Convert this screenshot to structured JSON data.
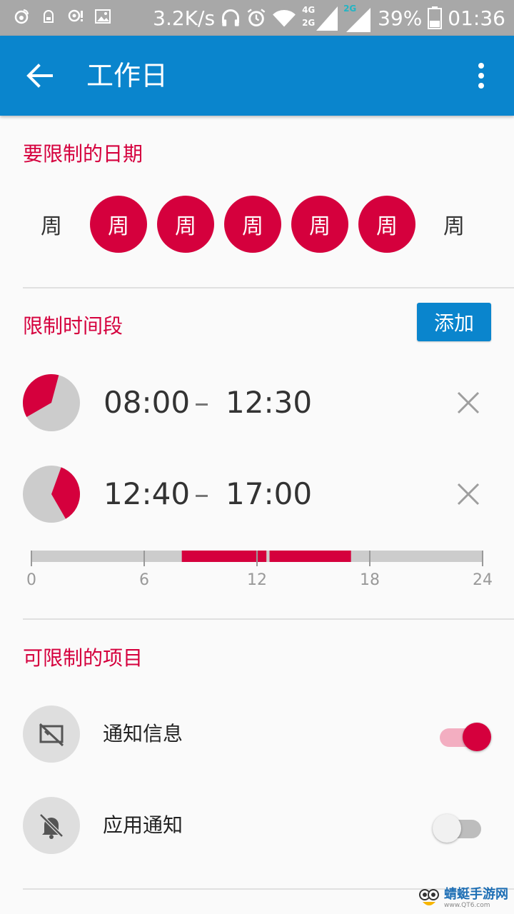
{
  "status_bar": {
    "speed": "3.2K/s",
    "network": "4G",
    "network_2": "2G",
    "battery": "39%",
    "time": "01:36",
    "icons": [
      "weibo-icon",
      "notification-robot-icon",
      "vpn-icon",
      "image-icon",
      "headphones-icon",
      "alarm-icon",
      "wifi-icon",
      "signal-icon"
    ]
  },
  "app_bar": {
    "title": "工作日",
    "back_icon": "arrow-left-icon",
    "menu_icon": "more-vert-icon"
  },
  "days_section": {
    "title": "要限制的日期",
    "days": [
      {
        "label": "周",
        "selected": false
      },
      {
        "label": "周",
        "selected": true
      },
      {
        "label": "周",
        "selected": true
      },
      {
        "label": "周",
        "selected": true
      },
      {
        "label": "周",
        "selected": true
      },
      {
        "label": "周",
        "selected": true
      },
      {
        "label": "周",
        "selected": false
      }
    ]
  },
  "periods_section": {
    "title": "限制时间段",
    "add_label": "添加",
    "periods": [
      {
        "start": "08:00",
        "end": "12:30",
        "separator": "–"
      },
      {
        "start": "12:40",
        "end": "17:00",
        "separator": "–"
      }
    ],
    "timeline": {
      "ticks": [
        "0",
        "6",
        "12",
        "18",
        "24"
      ],
      "range_hours": [
        0,
        24
      ]
    }
  },
  "items_section": {
    "title": "可限制的项目",
    "items": [
      {
        "label": "通知信息",
        "icon": "notification-info-off-icon",
        "enabled": true
      },
      {
        "label": "应用通知",
        "icon": "bell-off-icon",
        "enabled": false
      }
    ]
  },
  "watermark": {
    "text": "蜻蜓手游网",
    "sub": "www.QT6.com"
  },
  "colors": {
    "accent": "#d5003d",
    "primary": "#0a85cd",
    "track_off": "#cccccc"
  }
}
